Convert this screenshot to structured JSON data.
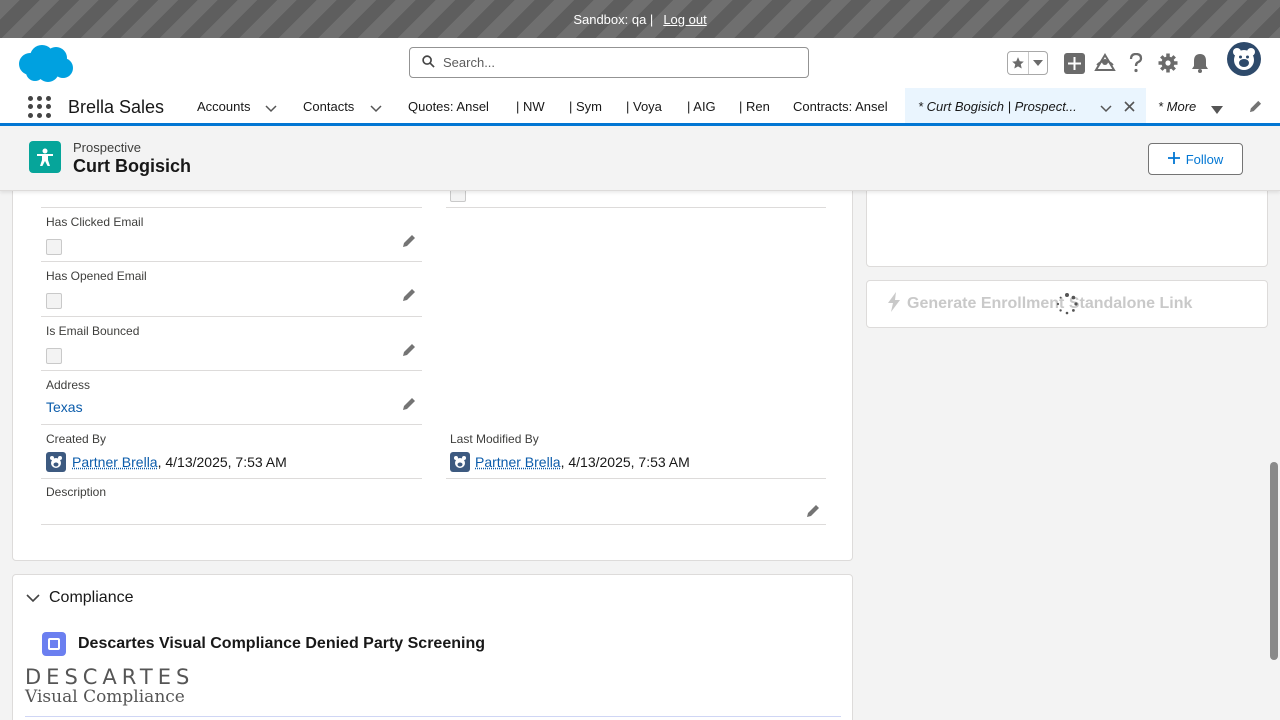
{
  "sandbox": {
    "text": "Sandbox: qa |",
    "logout": "Log out"
  },
  "search": {
    "placeholder": "Search..."
  },
  "nav": {
    "app_name": "Brella Sales",
    "items": [
      {
        "label": "Accounts"
      },
      {
        "label": "Contacts"
      },
      {
        "label": "Quotes: Ansel"
      },
      {
        "label": "| NW"
      },
      {
        "label": "| Sym"
      },
      {
        "label": "| Voya"
      },
      {
        "label": "| AIG"
      },
      {
        "label": "| Ren"
      },
      {
        "label": "Contracts: Ansel"
      }
    ],
    "active_tab": "* Curt Bogisich | Prospect...",
    "more": "* More"
  },
  "record": {
    "type": "Prospective",
    "name": "Curt Bogisich",
    "follow": "Follow"
  },
  "fields": {
    "has_clicked_email": "Has Clicked Email",
    "has_opened_email": "Has Opened Email",
    "is_email_bounced": "Is Email Bounced",
    "address_label": "Address",
    "address_value": "Texas",
    "created_by_label": "Created By",
    "created_by_user": "Partner Brella",
    "created_by_date": ", 4/13/2025, 7:53 AM",
    "modified_by_label": "Last Modified By",
    "modified_by_user": "Partner Brella",
    "modified_by_date": ", 4/13/2025, 7:53 AM",
    "description_label": "Description"
  },
  "right_panel": {
    "generate_button": "Generate Enrollment Standalone Link"
  },
  "compliance": {
    "section_title": "Compliance",
    "component_title": "Descartes Visual Compliance Denied Party Screening",
    "logo_top": "DESCARTES",
    "logo_bottom": "Visual Compliance"
  },
  "colors": {
    "brand": "#0176d3",
    "record_icon": "#06a59a",
    "link": "#0b5cab"
  }
}
